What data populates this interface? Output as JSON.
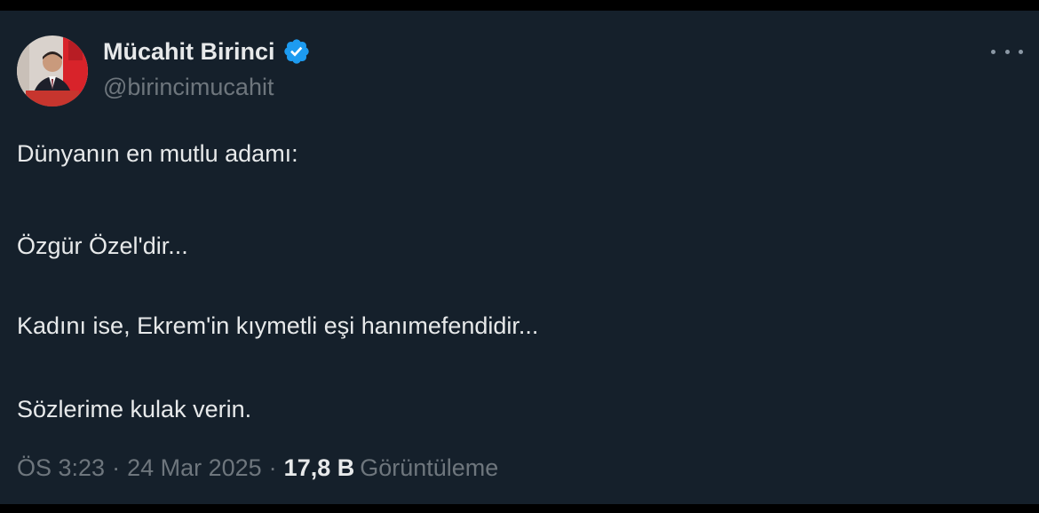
{
  "author": {
    "name": "Mücahit Birinci",
    "handle": "@birincimucahit",
    "verified": true,
    "avatar_icon": "profile-photo-icon"
  },
  "menu_icon": "more-options-icon",
  "tweet": {
    "lines": [
      "Dünyanın en mutlu adamı:",
      "Özgür Özel'dir...",
      "Kadını ise, Ekrem'in kıymetli eşi hanımefendidir...",
      "Sözlerime kulak verin."
    ]
  },
  "meta": {
    "time": "ÖS 3:23",
    "separator": "·",
    "date": "24 Mar 2025",
    "views_count": "17,8 B",
    "views_label": "Görüntüleme"
  },
  "colors": {
    "background": "#15202b",
    "text": "#e7e9ea",
    "muted": "#6e767d",
    "verified_badge": "#1d9bf0"
  }
}
